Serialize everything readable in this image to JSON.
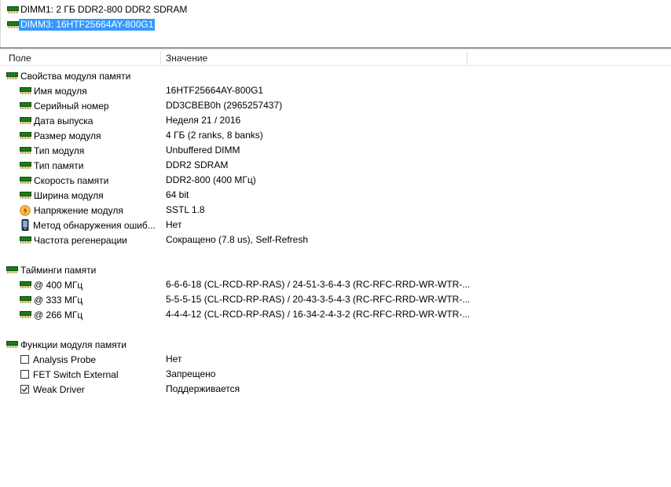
{
  "dimm_list": [
    {
      "label": "DIMM1: 2 ГБ DDR2-800 DDR2 SDRAM",
      "selected": false
    },
    {
      "label": "DIMM3: 16HTF25664AY-800G1",
      "selected": true
    }
  ],
  "columns": {
    "field": "Поле",
    "value": "Значение"
  },
  "sections": {
    "props": {
      "title": "Свойства модуля памяти",
      "rows": [
        {
          "field": "Имя модуля",
          "value": "16HTF25664AY-800G1",
          "icon": "ram-icon"
        },
        {
          "field": "Серийный номер",
          "value": "DD3CBEB0h (2965257437)",
          "icon": "ram-icon"
        },
        {
          "field": "Дата выпуска",
          "value": "Неделя 21 / 2016",
          "icon": "ram-icon"
        },
        {
          "field": "Размер модуля",
          "value": "4 ГБ (2 ranks, 8 banks)",
          "icon": "ram-icon"
        },
        {
          "field": "Тип модуля",
          "value": "Unbuffered DIMM",
          "icon": "ram-icon"
        },
        {
          "field": "Тип памяти",
          "value": "DDR2 SDRAM",
          "icon": "ram-icon"
        },
        {
          "field": "Скорость памяти",
          "value": "DDR2-800 (400 МГц)",
          "icon": "ram-icon"
        },
        {
          "field": "Ширина модуля",
          "value": "64 bit",
          "icon": "ram-icon"
        },
        {
          "field": "Напряжение модуля",
          "value": "SSTL 1.8",
          "icon": "lightning-icon"
        },
        {
          "field": "Метод обнаружения ошиб...",
          "value": "Нет",
          "icon": "phone-icon"
        },
        {
          "field": "Частота регенерации",
          "value": "Сокращено (7.8 us), Self-Refresh",
          "icon": "ram-icon"
        }
      ]
    },
    "timings": {
      "title": "Тайминги памяти",
      "rows": [
        {
          "field": "@ 400 МГц",
          "value": "6-6-6-18  (CL-RCD-RP-RAS) / 24-51-3-6-4-3  (RC-RFC-RRD-WR-WTR-..."
        },
        {
          "field": "@ 333 МГц",
          "value": "5-5-5-15  (CL-RCD-RP-RAS) / 20-43-3-5-4-3  (RC-RFC-RRD-WR-WTR-..."
        },
        {
          "field": "@ 266 МГц",
          "value": "4-4-4-12  (CL-RCD-RP-RAS) / 16-34-2-4-3-2  (RC-RFC-RRD-WR-WTR-..."
        }
      ]
    },
    "functions": {
      "title": "Функции модуля памяти",
      "rows": [
        {
          "field": "Analysis Probe",
          "value": "Нет",
          "checked": false
        },
        {
          "field": "FET Switch External",
          "value": "Запрещено",
          "checked": false
        },
        {
          "field": "Weak Driver",
          "value": "Поддерживается",
          "checked": true
        }
      ]
    }
  }
}
